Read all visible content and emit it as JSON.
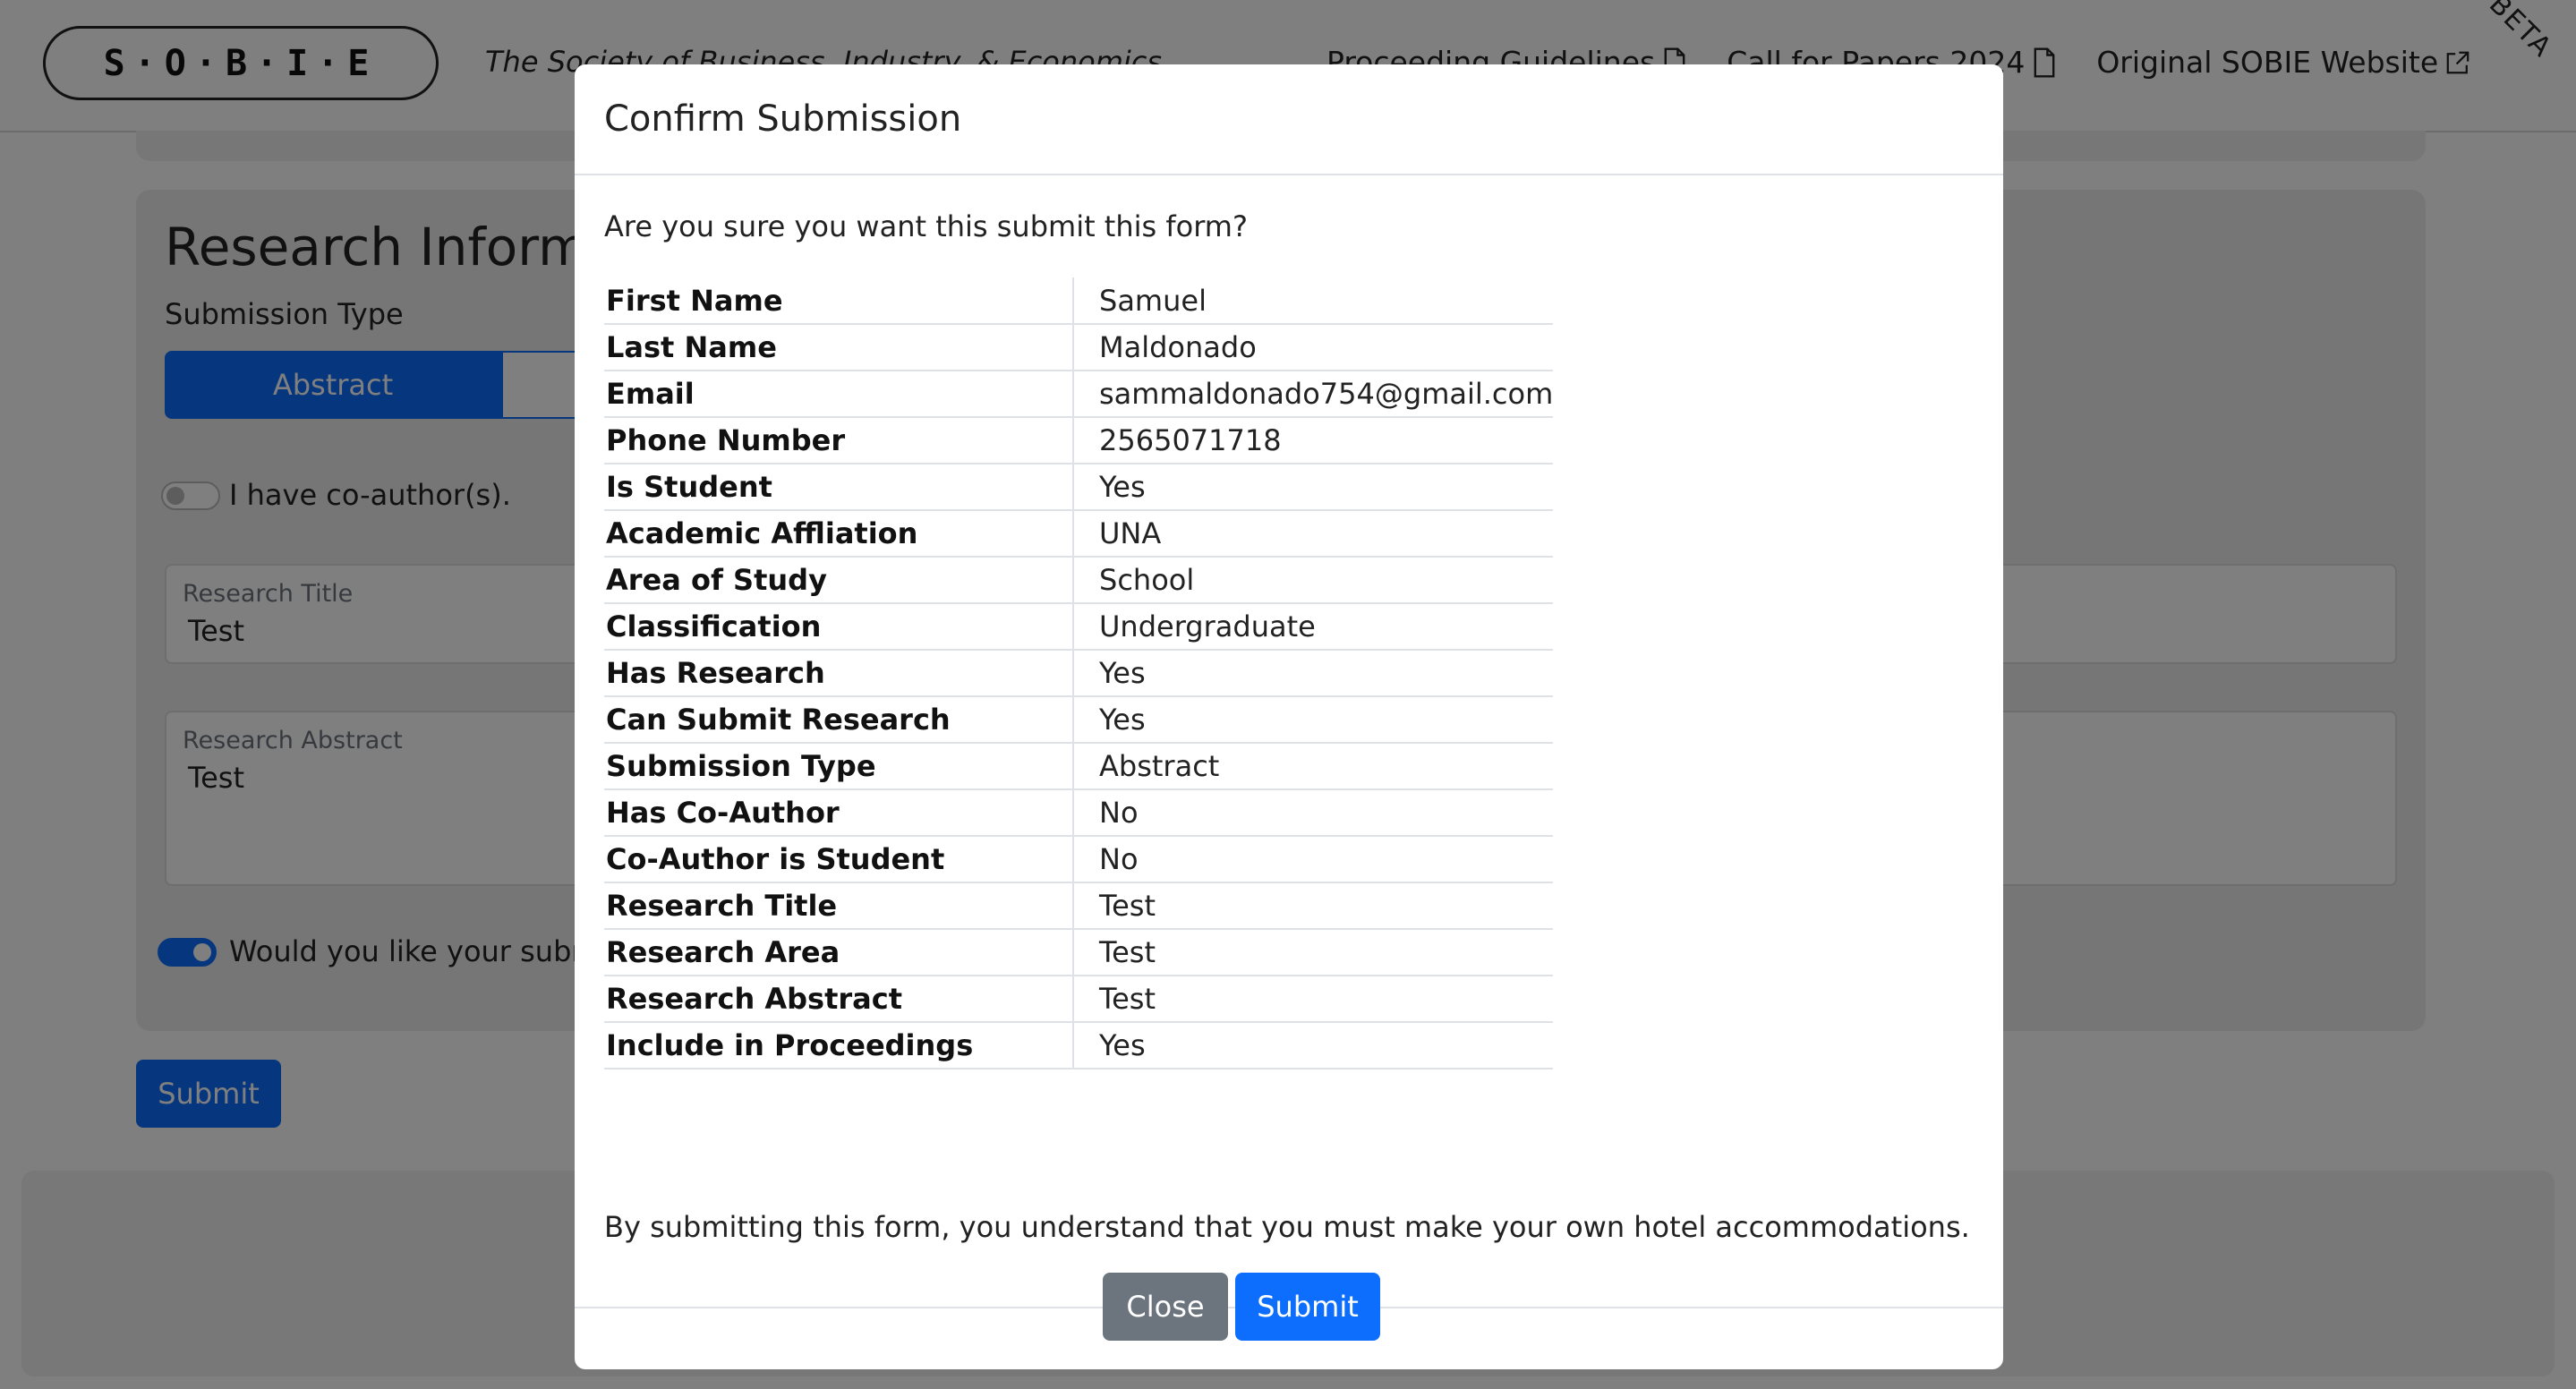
{
  "header": {
    "logo": "S·O·B·I·E",
    "tagline": "The Society of Business, Industry, & Economics",
    "nav": [
      {
        "label": "Proceeding Guidelines",
        "icon": "document-icon"
      },
      {
        "label": "Call for Papers 2024",
        "icon": "document-icon"
      },
      {
        "label": "Original SOBIE Website",
        "icon": "external-link-icon"
      }
    ],
    "beta": "BETA"
  },
  "form": {
    "heading": "Research Information",
    "submission_type_label": "Submission Type",
    "submission_type_options": [
      "Abstract",
      ""
    ],
    "coauthor_label": "I have co-author(s).",
    "coauthor_toggle": false,
    "research_title_label": "Research Title",
    "research_title_value": "Test",
    "research_abstract_label": "Research Abstract",
    "research_abstract_value": "Test",
    "proceedings_label": "Would you like your submission included in the proceedings?",
    "proceedings_toggle": true,
    "submit_label": "Submit"
  },
  "modal": {
    "title": "Confirm Submission",
    "question": "Are you sure you want this submit this form?",
    "rows": [
      {
        "key": "First Name",
        "value": "Samuel"
      },
      {
        "key": "Last Name",
        "value": "Maldonado"
      },
      {
        "key": "Email",
        "value": "sammaldonado754@gmail.com"
      },
      {
        "key": "Phone Number",
        "value": "2565071718"
      },
      {
        "key": "Is Student",
        "value": "Yes"
      },
      {
        "key": "Academic Affliation",
        "value": "UNA"
      },
      {
        "key": "Area of Study",
        "value": "School"
      },
      {
        "key": "Classification",
        "value": "Undergraduate"
      },
      {
        "key": "Has Research",
        "value": "Yes"
      },
      {
        "key": "Can Submit Research",
        "value": "Yes"
      },
      {
        "key": "Submission Type",
        "value": "Abstract"
      },
      {
        "key": "Has Co-Author",
        "value": "No"
      },
      {
        "key": "Co-Author is Student",
        "value": "No"
      },
      {
        "key": "Research Title",
        "value": "Test"
      },
      {
        "key": "Research Area",
        "value": "Test"
      },
      {
        "key": "Research Abstract",
        "value": "Test"
      },
      {
        "key": "Include in Proceedings",
        "value": "Yes"
      }
    ],
    "note": "By submitting this form, you understand that you must make your own hotel accommodations.",
    "close_label": "Close",
    "submit_label": "Submit"
  },
  "colors": {
    "primary": "#0d6efd",
    "secondary": "#6c757d",
    "backdrop": "rgba(0,0,0,0.5)"
  }
}
